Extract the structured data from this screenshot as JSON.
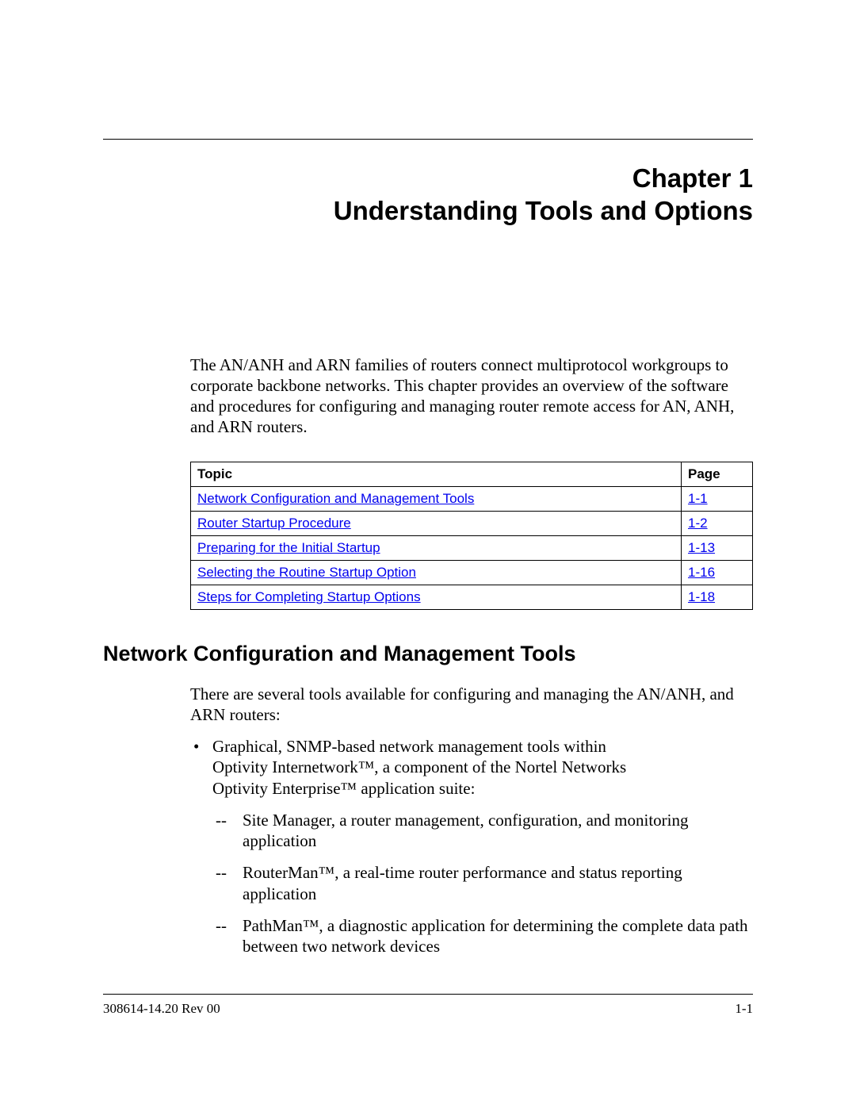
{
  "chapter": {
    "line1": "Chapter 1",
    "line2": "Understanding Tools and Options"
  },
  "intro": "The AN/ANH and ARN families of routers connect multiprotocol workgroups to corporate backbone networks. This chapter provides an overview of the software and procedures for configuring and managing router remote access for AN, ANH, and ARN routers.",
  "toc": {
    "headers": {
      "topic": "Topic",
      "page": "Page"
    },
    "rows": [
      {
        "topic": "Network Configuration and Management Tools",
        "page": "1-1"
      },
      {
        "topic": "Router Startup Procedure",
        "page": "1-2"
      },
      {
        "topic": "Preparing for the Initial Startup",
        "page": "1-13"
      },
      {
        "topic": "Selecting the Routine Startup Option",
        "page": "1-16"
      },
      {
        "topic": "Steps for Completing Startup Options",
        "page": "1-18"
      }
    ]
  },
  "section_heading": "Network Configuration and Management Tools",
  "section_intro": "There are several tools available for configuring and managing the AN/ANH, and ARN routers:",
  "bullet1": "Graphical, SNMP-based network management tools within Optivity Internetwork™, a component of the Nortel Networks Optivity Enterprise™ application suite:",
  "sub1": "Site Manager, a router management, configuration, and monitoring application",
  "sub2": "RouterMan™, a real-time router performance and status reporting application",
  "sub3": "PathMan™, a diagnostic application for determining the complete data path between two network devices",
  "footer": {
    "left": "308614-14.20 Rev 00",
    "right": "1-1"
  }
}
